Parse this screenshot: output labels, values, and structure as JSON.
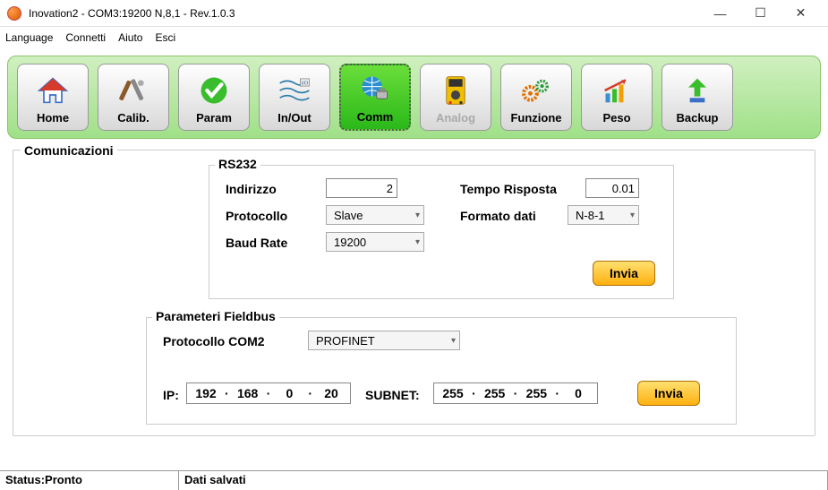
{
  "window": {
    "title": "Inovation2 - COM3:19200 N,8,1 - Rev.1.0.3"
  },
  "menu": {
    "language": "Language",
    "connetti": "Connetti",
    "aiuto": "Aiuto",
    "esci": "Esci"
  },
  "toolbar": {
    "home": "Home",
    "calib": "Calib.",
    "param": "Param",
    "inout": "In/Out",
    "comm": "Comm",
    "analog": "Analog",
    "funzione": "Funzione",
    "peso": "Peso",
    "backup": "Backup"
  },
  "panel": {
    "title": "Comunicazioni",
    "rs232": {
      "title": "RS232",
      "indirizzo_label": "Indirizzo",
      "indirizzo_value": "2",
      "protocollo_label": "Protocollo",
      "protocollo_value": "Slave",
      "baud_label": "Baud Rate",
      "baud_value": "19200",
      "tempo_label": "Tempo Risposta",
      "tempo_value": "0.01",
      "formato_label": "Formato dati",
      "formato_value": "N-8-1",
      "send": "Invia"
    },
    "fieldbus": {
      "title": "Parameteri Fieldbus",
      "protocollo_label": "Protocollo COM2",
      "protocollo_value": "PROFINET",
      "ip_label": "IP:",
      "ip": [
        "192",
        "168",
        "0",
        "20"
      ],
      "subnet_label": "SUBNET:",
      "subnet": [
        "255",
        "255",
        "255",
        "0"
      ],
      "send": "Invia"
    }
  },
  "status": {
    "left": "Status:Pronto",
    "right": "Dati salvati"
  }
}
